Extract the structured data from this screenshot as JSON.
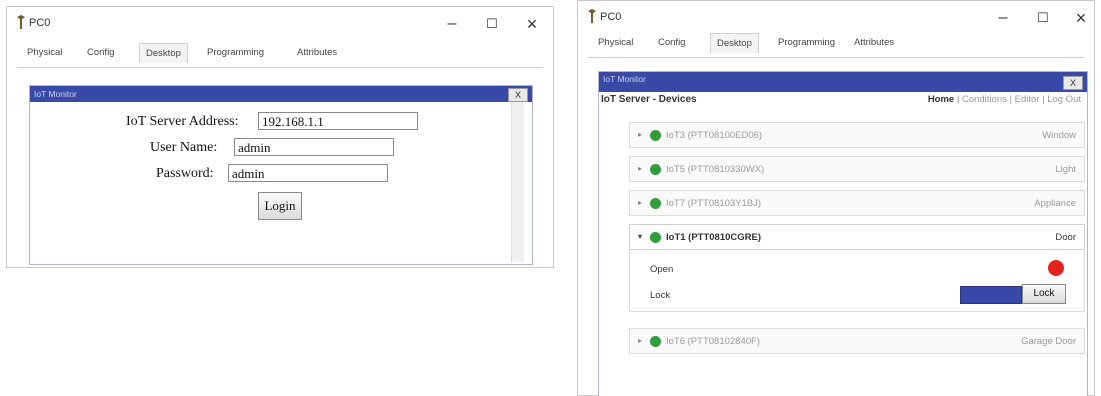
{
  "left_window": {
    "title": "PC0",
    "controls": {
      "minimize": "–",
      "maximize": "☐",
      "close": "×"
    },
    "tabs": [
      {
        "label": "Physical",
        "active": false
      },
      {
        "label": "Config",
        "active": false
      },
      {
        "label": "Desktop",
        "active": true
      },
      {
        "label": "Programming",
        "active": false
      },
      {
        "label": "Attributes",
        "active": false
      }
    ],
    "panel_title": "IoT Monitor",
    "panel_close": "X",
    "form": {
      "server_label": "IoT Server Address:",
      "server_value": "192.168.1.1",
      "username_label": "User Name:",
      "username_value": "admin",
      "password_label": "Password:",
      "password_value": "admin",
      "login_button": "Login"
    }
  },
  "right_window": {
    "title": "PC0",
    "controls": {
      "minimize": "–",
      "maximize": "☐",
      "close": "×"
    },
    "tabs": [
      {
        "label": "Physical",
        "active": false
      },
      {
        "label": "Config",
        "active": false
      },
      {
        "label": "Desktop",
        "active": true
      },
      {
        "label": "Programming",
        "active": false
      },
      {
        "label": "Attributes",
        "active": false
      }
    ],
    "panel_title": "IoT Monitor",
    "panel_close": "X",
    "header": {
      "title": "IoT Server - Devices",
      "nav_home": "Home",
      "nav_conditions": "Conditions",
      "nav_editor": "Editor",
      "nav_logout": "Log Out",
      "sep": "|"
    },
    "devices": [
      {
        "name": "IoT3 (PTT08100ED06)",
        "type": "Window",
        "expanded": false
      },
      {
        "name": "IoT5 (PTT0810330WX)",
        "type": "Light",
        "expanded": false
      },
      {
        "name": "IoT7 (PTT08103Y1BJ)",
        "type": "Appliance",
        "expanded": false
      },
      {
        "name": "IoT1 (PTT0810CGRE)",
        "type": "Door",
        "expanded": true
      },
      {
        "name": "IoT6 (PTT08102840F)",
        "type": "Garage Door",
        "expanded": false
      }
    ],
    "door_attributes": {
      "open_label": "Open",
      "lock_label": "Lock",
      "lock_button": "Lock",
      "open_state_color": "#e3231b"
    },
    "status_colors": {
      "online": "#2f9d3a",
      "accent": "#3949a8"
    }
  }
}
